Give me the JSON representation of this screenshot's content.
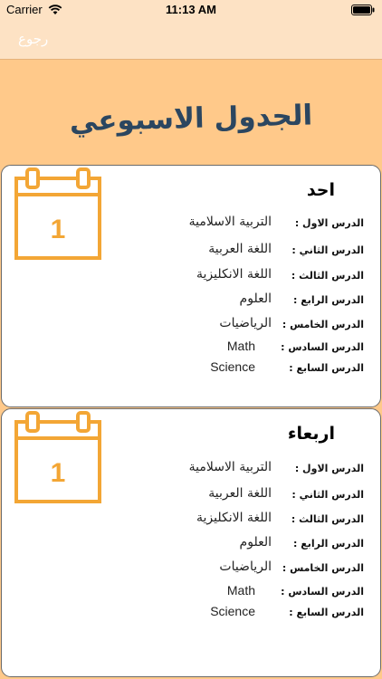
{
  "status_bar": {
    "carrier": "Carrier",
    "time": "11:13 AM"
  },
  "nav": {
    "back_label": "رجوع"
  },
  "page_title": "الجدول الاسبوعي",
  "colors": {
    "background": "#ffc98a",
    "bar": "#fde2c4",
    "calendar": "#f3a635",
    "title": "#2b4660"
  },
  "days": [
    {
      "name": "احد",
      "calendar_day": "1",
      "lessons": [
        {
          "label": "الدرس الاول :",
          "subject": "التربية الاسلامية"
        },
        {
          "label": "الدرس الثاني :",
          "subject": "اللغة العربية"
        },
        {
          "label": "الدرس الثالث :",
          "subject": "اللغة الانكليزية"
        },
        {
          "label": "الدرس الرابع :",
          "subject": "العلوم"
        },
        {
          "label": "الدرس الخامس :",
          "subject": "الرياضيات"
        },
        {
          "label": "الدرس السادس :",
          "subject": "Math"
        },
        {
          "label": "الدرس السابع :",
          "subject": "Science"
        }
      ]
    },
    {
      "name": "اربعاء",
      "calendar_day": "1",
      "lessons": [
        {
          "label": "الدرس الاول :",
          "subject": "التربية الاسلامية"
        },
        {
          "label": "الدرس الثاني :",
          "subject": "اللغة العربية"
        },
        {
          "label": "الدرس الثالث :",
          "subject": "اللغة الانكليزية"
        },
        {
          "label": "الدرس الرابع :",
          "subject": "العلوم"
        },
        {
          "label": "الدرس الخامس :",
          "subject": "الرياضيات"
        },
        {
          "label": "الدرس السادس :",
          "subject": "Math"
        },
        {
          "label": "الدرس السابع :",
          "subject": "Science"
        }
      ]
    }
  ]
}
